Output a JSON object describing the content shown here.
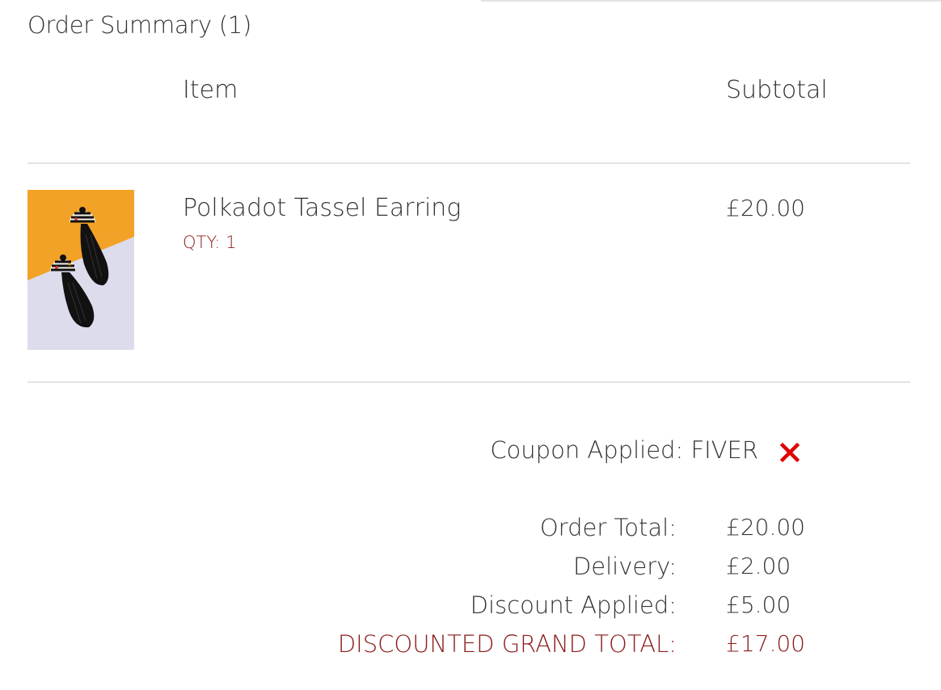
{
  "summary": {
    "title": "Order Summary (1)"
  },
  "table": {
    "headers": {
      "item": "Item",
      "subtotal": "Subtotal"
    },
    "items": [
      {
        "name": "Polkadot Tassel Earring",
        "qty_label": "QTY: 1",
        "subtotal": "£20.00",
        "image_icon": "product-photo-earrings"
      }
    ]
  },
  "coupon": {
    "label": "Coupon Applied: FIVER",
    "remove_icon": "close-icon",
    "remove_color": "#e00000"
  },
  "totals": {
    "order_total_label": "Order Total:",
    "order_total_value": "£20.00",
    "delivery_label": "Delivery:",
    "delivery_value": "£2.00",
    "discount_label": "Discount Applied:",
    "discount_value": "£5.00",
    "grand_total_label": "DISCOUNTED GRAND TOTAL:",
    "grand_total_value": "£17.00"
  },
  "colors": {
    "accent": "#8b1a1a",
    "text": "#333333",
    "divider": "#e3e3e3"
  }
}
